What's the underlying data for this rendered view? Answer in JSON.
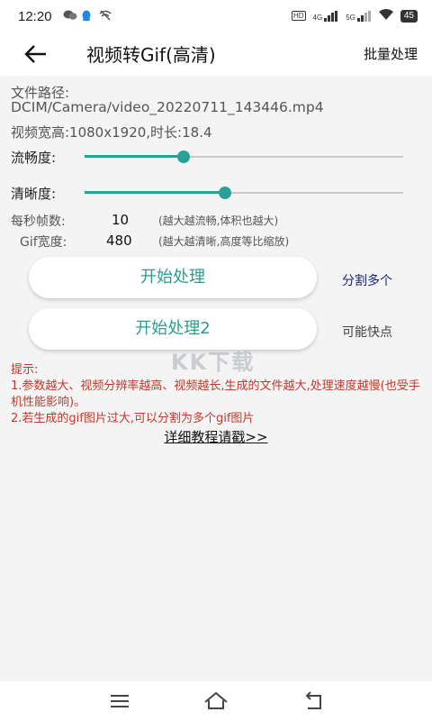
{
  "status": {
    "time": "12:20",
    "network_label": "4G",
    "network_label2": "5G",
    "hd_label": "HD",
    "battery": "45"
  },
  "app_bar": {
    "title": "视频转Gif(高清)",
    "batch_label": "批量处理"
  },
  "file": {
    "path_label": "文件路径:",
    "path": "DCIM/Camera/video_20220711_143446.mp4",
    "info": "视频宽高:1080x1920,时长:18.4"
  },
  "sliders": {
    "fluency": {
      "label": "流畅度:",
      "value": 0.31
    },
    "clarity": {
      "label": "清晰度:",
      "value": 0.44
    }
  },
  "params": {
    "fps": {
      "label": "每秒帧数:",
      "value": "10",
      "hint": "(越大越流畅,体积也越大)"
    },
    "gif_width": {
      "label": "Gif宽度:",
      "value": "480",
      "hint": "(越大越清晰,高度等比缩放)"
    }
  },
  "buttons": {
    "start": "开始处理",
    "start2": "开始处理2",
    "split": "分割多个",
    "fast": "可能快点"
  },
  "tips": {
    "title": "提示:",
    "line1": "1.参数越大、视频分辨率越高、视频越长,生成的文件越大,处理速度越慢(也受手机性能影响)。",
    "line2": "2.若生成的gif图片过大,可以分割为多个gif图片"
  },
  "tutorial": "详细教程请戳>>",
  "watermark": "KK下载",
  "colors": {
    "accent": "#2aa198",
    "tips": "#c0392b",
    "split_link": "#1a237e"
  }
}
